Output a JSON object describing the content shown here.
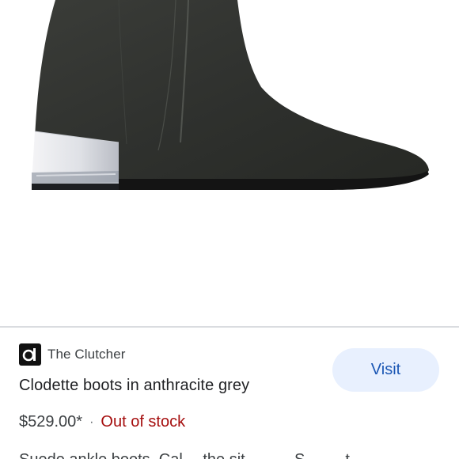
{
  "image": {
    "alt": "Clodette boots in anthracite grey"
  },
  "seller": {
    "logo_icon": "clutcher-logo-icon",
    "name": "The Clutcher"
  },
  "product": {
    "title": "Clodette boots in anthracite grey",
    "price": "$529.00*",
    "separator": "·",
    "stock_status": "Out of stock",
    "description_partial": "Suede ankle boots. Cal… the sit… ….. S… ….t"
  },
  "actions": {
    "visit_label": "Visit"
  },
  "colors": {
    "visit_bg": "#e8f0fe",
    "visit_text": "#1a56b4",
    "out_of_stock": "#a50e0e",
    "divider": "#dadce0"
  }
}
